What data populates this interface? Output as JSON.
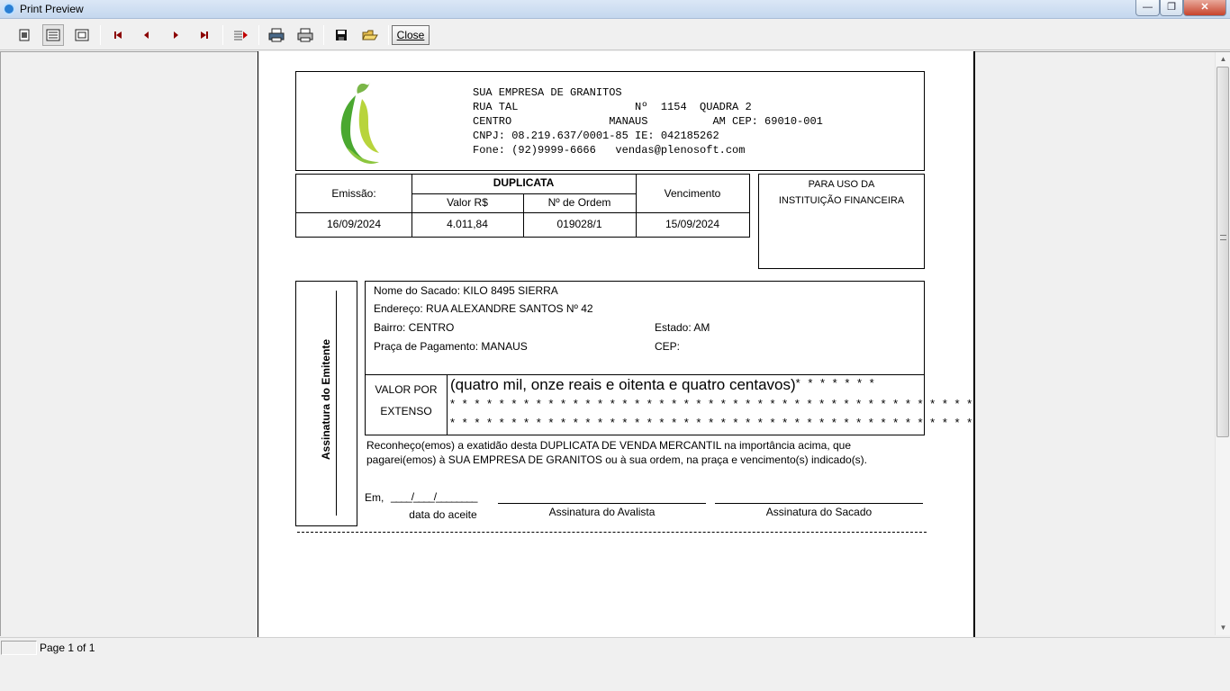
{
  "window": {
    "title": "Print Preview",
    "min": "—",
    "max": "❐",
    "close": "✕"
  },
  "toolbar": {
    "close_label": "Close"
  },
  "company": {
    "name": "SUA EMPRESA DE GRANITOS",
    "line2": "RUA TAL                  Nº  1154  QUADRA 2",
    "line3": "CENTRO               MANAUS          AM CEP: 69010-001",
    "line4": "CNPJ: 08.219.637/0001-85 IE: 042185262",
    "line5": "Fone: (92)9999-6666   vendas@plenosoft.com"
  },
  "duplicata": {
    "header": "DUPLICATA",
    "emissao_label": "Emissão:",
    "valor_label": "Valor R$",
    "ordem_label": "Nº de Ordem",
    "vencimento_label": "Vencimento",
    "emissao": "16/09/2024",
    "valor": "4.011,84",
    "ordem": "019028/1",
    "vencimento": "15/09/2024"
  },
  "instituicao": {
    "line1": "PARA USO DA",
    "line2": "INSTITUIÇÃO FINANCEIRA"
  },
  "emitente": {
    "label": "Assinatura do Emitente"
  },
  "sacado": {
    "nome": "Nome do Sacado: KILO 8495 SIERRA",
    "endereco": "Endereço: RUA ALEXANDRE SANTOS Nº 42",
    "bairro": "Bairro: CENTRO",
    "estado": "Estado: AM",
    "praca": "Praça de Pagamento: MANAUS",
    "cep": "CEP:"
  },
  "extenso": {
    "label1": "VALOR POR",
    "label2": "EXTENSO",
    "line1_text": "(quatro mil, onze reais e oitenta e quatro centavos)",
    "line1_stars": "* * * * * * *",
    "line2": "* * * * * * * * * * * * * * * * * * * * * * * * * * * * * * * * * * * * * * * * * * *",
    "line3": "* * * * * * * * * * * * * * * * * * * * * * * * * * * * * * * * * * * * * * * * * * *"
  },
  "reconhecimento": {
    "line1": "Reconheço(emos) a exatidão desta DUPLICATA DE VENDA MERCANTIL na importância acima, que",
    "line2": "pagarei(emos) à SUA EMPRESA DE GRANITOS ou à sua ordem, na praça e vencimento(s) indicado(s)."
  },
  "assinaturas": {
    "em": "Em,",
    "data_blanks": "____/____/________",
    "data_label": "data do aceite",
    "avalista": "Assinatura do Avalista",
    "sacado": "Assinatura do Sacado"
  },
  "status": {
    "page": "Page 1 of 1"
  }
}
